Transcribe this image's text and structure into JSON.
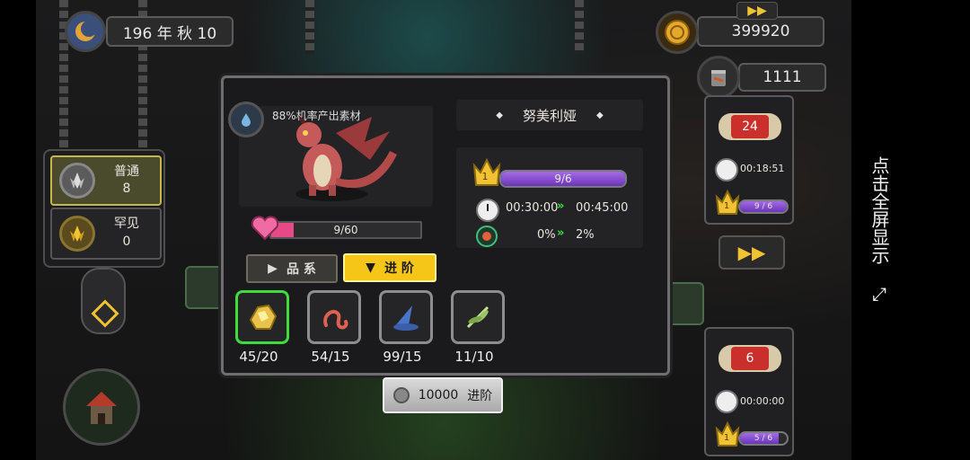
{
  "hud": {
    "date_label": "196 年 秋 10",
    "coins": "399920",
    "items": "1111"
  },
  "left_panel": {
    "rarity": [
      {
        "label": "普通",
        "count": "8"
      },
      {
        "label": "罕见",
        "count": "0"
      }
    ]
  },
  "dialog": {
    "drop_text": "88%机率产出素材",
    "dragon_name": "努美利娅",
    "affection": "9/60",
    "level_badge": "1",
    "level_progress_text": "9/6",
    "level_progress": 1.0,
    "time_current": "00:30:00",
    "time_next": "00:45:00",
    "rate_current": "0%",
    "rate_next": "2%",
    "tabs": [
      {
        "label": "品 系",
        "active": false
      },
      {
        "label": "进 阶",
        "active": true
      }
    ],
    "materials": [
      {
        "name": "gold-nugget",
        "count": "45/20",
        "selected": true
      },
      {
        "name": "red-worm",
        "count": "54/15",
        "selected": false
      },
      {
        "name": "blue-hat",
        "count": "99/15",
        "selected": false
      },
      {
        "name": "dragonfly-wing",
        "count": "11/10",
        "selected": false
      }
    ],
    "upgrade_cost": "10000",
    "upgrade_label": "进阶"
  },
  "right_side": {
    "card1": {
      "badge": "24",
      "timer": "00:18:51",
      "crown_level": "1",
      "progress_text": "9 / 6",
      "progress": 1.0
    },
    "card2": {
      "badge": "6",
      "timer": "00:00:00",
      "crown_level": "1",
      "progress_text": "5 / 6",
      "progress": 0.83
    }
  },
  "fullscreen_hint": "点击全屏显示",
  "colors": {
    "accent_gold": "#f1c232",
    "purple": "#8a4fd6",
    "selected_green": "#3fdc3f",
    "badge_red": "#c9302c"
  }
}
